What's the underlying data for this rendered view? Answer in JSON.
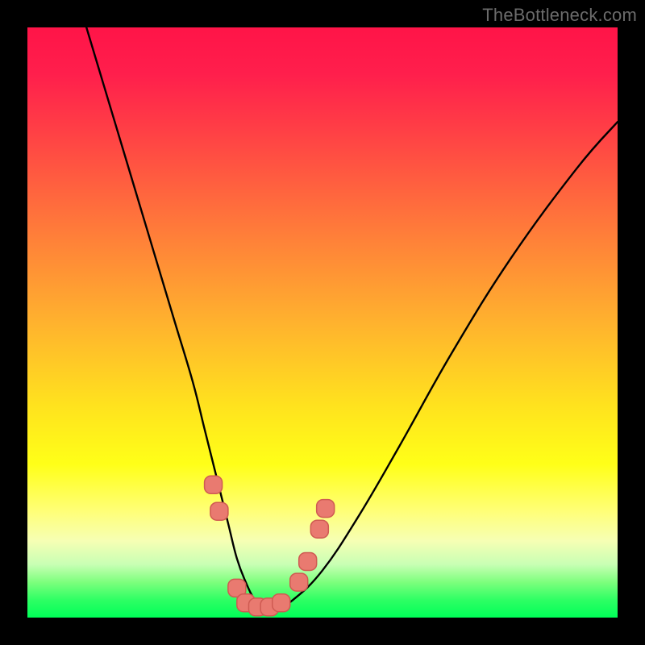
{
  "watermark": "TheBottleneck.com",
  "colors": {
    "frame": "#000000",
    "curve_stroke": "#000000",
    "marker_fill": "#e97a70",
    "marker_stroke": "#cf5a52",
    "gradient_top": "#ff1448",
    "gradient_bottom": "#00ff58"
  },
  "chart_data": {
    "type": "line",
    "title": "",
    "xlabel": "",
    "ylabel": "",
    "xlim": [
      0,
      100
    ],
    "ylim": [
      0,
      100
    ],
    "grid": false,
    "legend": false,
    "series": [
      {
        "name": "bottleneck-curve",
        "x": [
          10,
          13,
          16,
          19,
          22,
          25,
          28,
          30,
          32,
          34,
          35.5,
          37,
          38.5,
          40,
          42,
          45,
          50,
          56,
          63,
          72,
          82,
          93,
          100
        ],
        "y": [
          100,
          90,
          80,
          70,
          60,
          50,
          40,
          32,
          24,
          16,
          10,
          6,
          3,
          1.5,
          1.5,
          3,
          8,
          17,
          29,
          45,
          61,
          76,
          84
        ]
      }
    ],
    "markers": [
      {
        "x": 31.5,
        "y": 22.5
      },
      {
        "x": 32.5,
        "y": 18.0
      },
      {
        "x": 35.5,
        "y": 5.0
      },
      {
        "x": 37.0,
        "y": 2.5
      },
      {
        "x": 39.0,
        "y": 1.8
      },
      {
        "x": 41.0,
        "y": 1.8
      },
      {
        "x": 43.0,
        "y": 2.5
      },
      {
        "x": 46.0,
        "y": 6.0
      },
      {
        "x": 47.5,
        "y": 9.5
      },
      {
        "x": 49.5,
        "y": 15.0
      },
      {
        "x": 50.5,
        "y": 18.5
      }
    ]
  }
}
